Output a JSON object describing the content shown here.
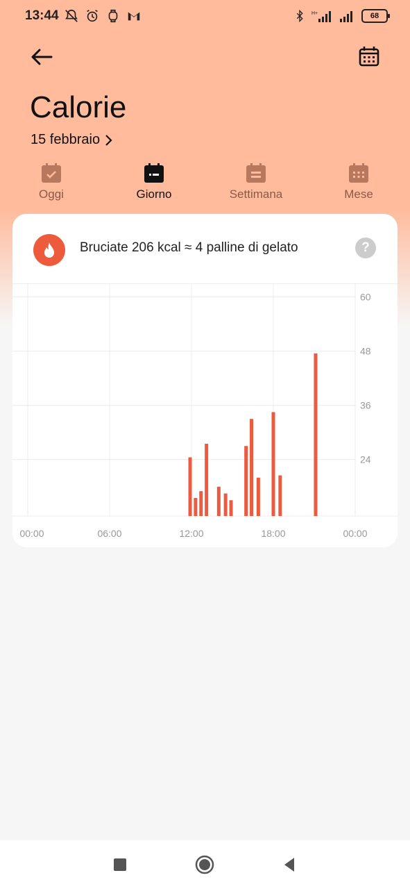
{
  "status_bar": {
    "time": "13:44",
    "battery": "68",
    "left_icons": [
      "bell-off-icon",
      "alarm-icon",
      "watch-icon",
      "gmail-icon"
    ],
    "right_icons": [
      "bluetooth-icon",
      "signal-hplus-icon",
      "signal-icon"
    ]
  },
  "header": {
    "title": "Calorie",
    "date": "15 febbraio",
    "back_icon": "arrow-left-icon",
    "calendar_icon": "calendar-icon"
  },
  "tabs": [
    {
      "label": "Oggi",
      "icon": "calendar-check-icon",
      "active": false
    },
    {
      "label": "Giorno",
      "icon": "calendar-day-icon",
      "active": true
    },
    {
      "label": "Settimana",
      "icon": "calendar-week-icon",
      "active": false
    },
    {
      "label": "Mese",
      "icon": "calendar-month-icon",
      "active": false
    }
  ],
  "card": {
    "summary": "Bruciate 206 kcal ≈ 4 palline di gelato",
    "help_label": "?"
  },
  "chart_data": {
    "type": "bar",
    "x_unit": "hour",
    "xlim": [
      0,
      24
    ],
    "ylim": [
      11.5,
      63
    ],
    "y_ticks": [
      60,
      48,
      36,
      24
    ],
    "x_tick_labels": [
      "00:00",
      "06:00",
      "12:00",
      "18:00",
      "00:00"
    ],
    "grid": true,
    "bar_color": "#ec5b40",
    "x": [
      11.9,
      12.3,
      12.7,
      13.1,
      14.0,
      14.5,
      14.9,
      16.0,
      16.4,
      16.9,
      18.0,
      18.5,
      21.1
    ],
    "values": [
      24.5,
      15.5,
      17,
      27.5,
      18,
      16.5,
      15,
      27,
      33,
      20,
      34.5,
      20.5,
      47.5
    ]
  },
  "colors": {
    "header_bg": "#ffbb9c",
    "accent": "#ee5a3c",
    "tab_inactive": "#b8785d"
  }
}
